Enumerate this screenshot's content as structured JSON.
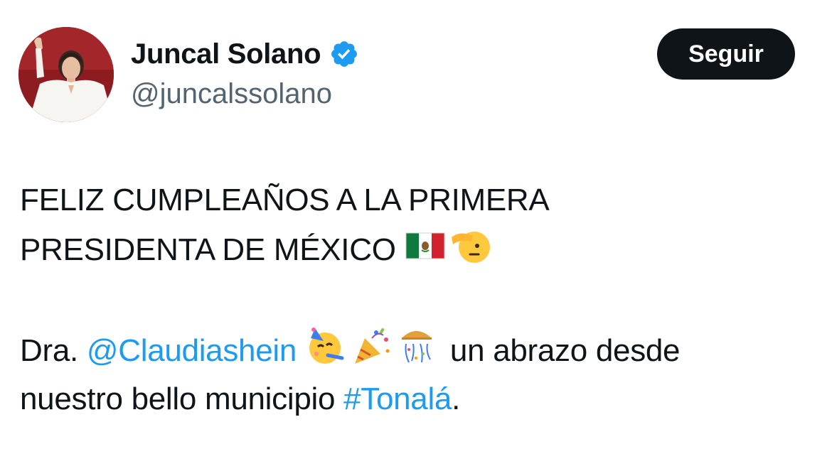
{
  "author": {
    "display_name": "Juncal Solano",
    "handle": "@juncalssolano",
    "verified_icon": "verified-badge-icon",
    "avatar_icon": "profile-avatar"
  },
  "follow_button": {
    "label": "Seguir"
  },
  "tweet": {
    "line1": "FELIZ CUMPLEAÑOS A LA PRIMERA",
    "line2": "PRESIDENTA DE MÉXICO",
    "emoji_line2": [
      "mexico-flag-icon",
      "saluting-face-icon"
    ],
    "line3_prefix": "Dra.",
    "mention": "@Claudiashein",
    "emoji_line3": [
      "partying-face-icon",
      "party-popper-icon",
      "confetti-ball-icon"
    ],
    "line3_suffix": "un abrazo desde",
    "line4_prefix": "nuestro bello municipio",
    "hashtag": "#Tonalá",
    "line4_suffix": "."
  },
  "colors": {
    "link": "#1d9bf0",
    "text": "#0f1419",
    "secondary": "#536471",
    "button_bg": "#0f1419",
    "verified": "#1d9bf0"
  }
}
